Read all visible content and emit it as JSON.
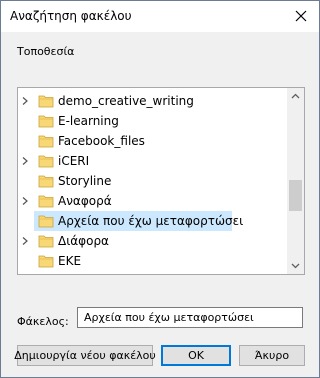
{
  "window": {
    "title": "Αναζήτηση φακέλου"
  },
  "location": {
    "label": "Τοποθεσία"
  },
  "tree": {
    "rows": [
      {
        "label": "demo_creative_writing",
        "expandable": true,
        "selected": false
      },
      {
        "label": "E-learning",
        "expandable": false,
        "selected": false
      },
      {
        "label": "Facebook_files",
        "expandable": false,
        "selected": false
      },
      {
        "label": "iCERI",
        "expandable": true,
        "selected": false
      },
      {
        "label": "Storyline",
        "expandable": false,
        "selected": false
      },
      {
        "label": "Αναφορά",
        "expandable": true,
        "selected": false
      },
      {
        "label": "Αρχεία που έχω μεταφορτώσει",
        "expandable": false,
        "selected": true
      },
      {
        "label": "Διάφορα",
        "expandable": true,
        "selected": false
      },
      {
        "label": "EKE",
        "expandable": false,
        "selected": false
      }
    ],
    "scroll_position": 0.62,
    "visible_fraction": 0.2
  },
  "folder": {
    "label": "Φάκελος:",
    "value": "Αρχεία που έχω μεταφορτώσει"
  },
  "buttons": {
    "new_folder": "Δημιουργία νέου φακέλου",
    "ok": "OK",
    "cancel": "Άκυρο"
  },
  "colors": {
    "selection": "#cce8ff",
    "folder": "#f8d775",
    "accent": "#0078d7"
  }
}
